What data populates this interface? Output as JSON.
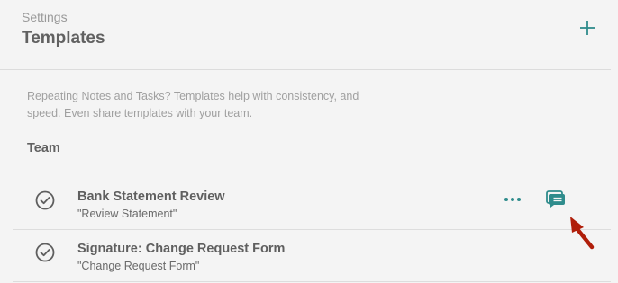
{
  "header": {
    "breadcrumb": "Settings",
    "title": "Templates",
    "add_icon": "plus-icon"
  },
  "description": "Repeating Notes and Tasks? Templates help with consistency, and speed. Even share templates with your team.",
  "section": {
    "label": "Team"
  },
  "templates": [
    {
      "title": "Bank Statement Review",
      "subtitle": "\"Review Statement\"",
      "icon": "check-circle-icon",
      "actions": [
        "more-icon",
        "chat-icon"
      ]
    },
    {
      "title": "Signature: Change Request Form",
      "subtitle": "\"Change Request Form\"",
      "icon": "check-circle-icon"
    }
  ],
  "colors": {
    "accent": "#2f8c8c",
    "pointer": "#b01e0a",
    "background": "#f4f4f4"
  }
}
